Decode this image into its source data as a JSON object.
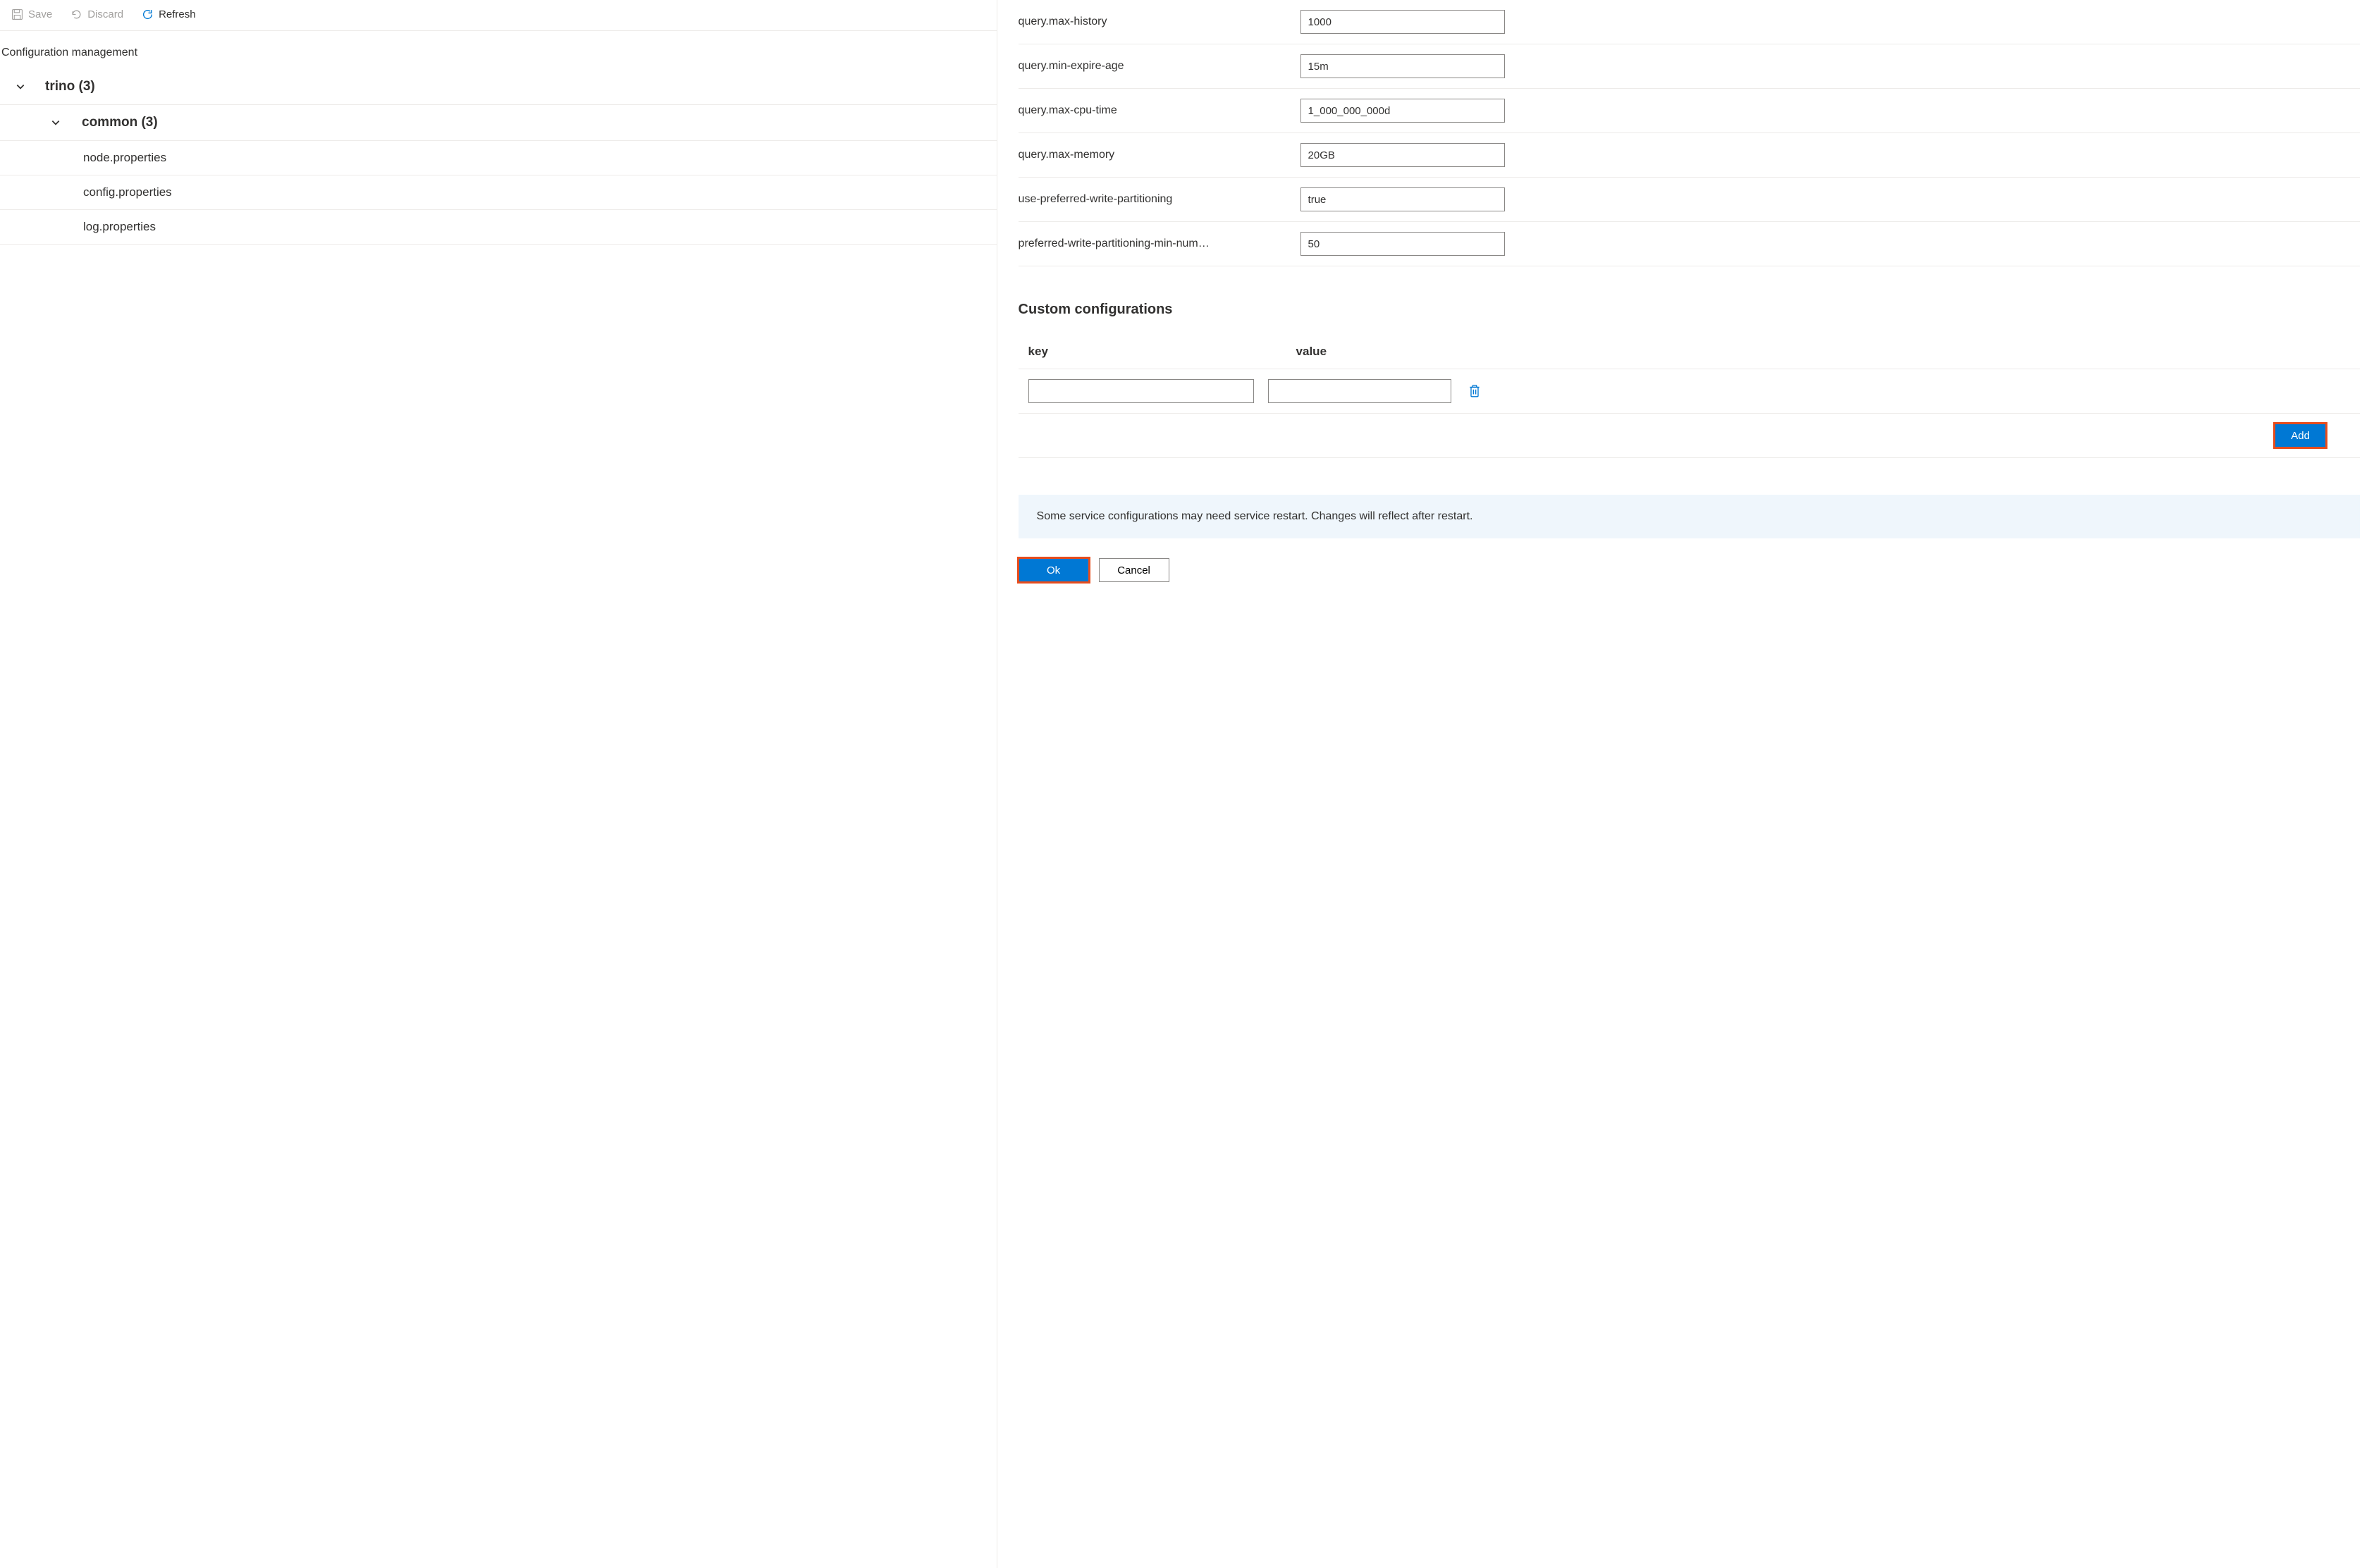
{
  "toolbar": {
    "save": "Save",
    "discard": "Discard",
    "refresh": "Refresh"
  },
  "left": {
    "title": "Configuration management",
    "tree": {
      "root_label": "trino (3)",
      "group_label": "common (3)",
      "items": [
        "node.properties",
        "config.properties",
        "log.properties"
      ]
    }
  },
  "configs": [
    {
      "key": "query.max-history",
      "value": "1000"
    },
    {
      "key": "query.min-expire-age",
      "value": "15m"
    },
    {
      "key": "query.max-cpu-time",
      "value": "1_000_000_000d"
    },
    {
      "key": "query.max-memory",
      "value": "20GB"
    },
    {
      "key": "use-preferred-write-partitioning",
      "value": "true"
    },
    {
      "key": "preferred-write-partitioning-min-num…",
      "value": "50"
    }
  ],
  "custom": {
    "title": "Custom configurations",
    "key_header": "key",
    "value_header": "value",
    "rows": [
      {
        "key": "",
        "value": ""
      }
    ],
    "add_label": "Add"
  },
  "info": "Some service configurations may need service restart. Changes will reflect after restart.",
  "actions": {
    "ok": "Ok",
    "cancel": "Cancel"
  }
}
